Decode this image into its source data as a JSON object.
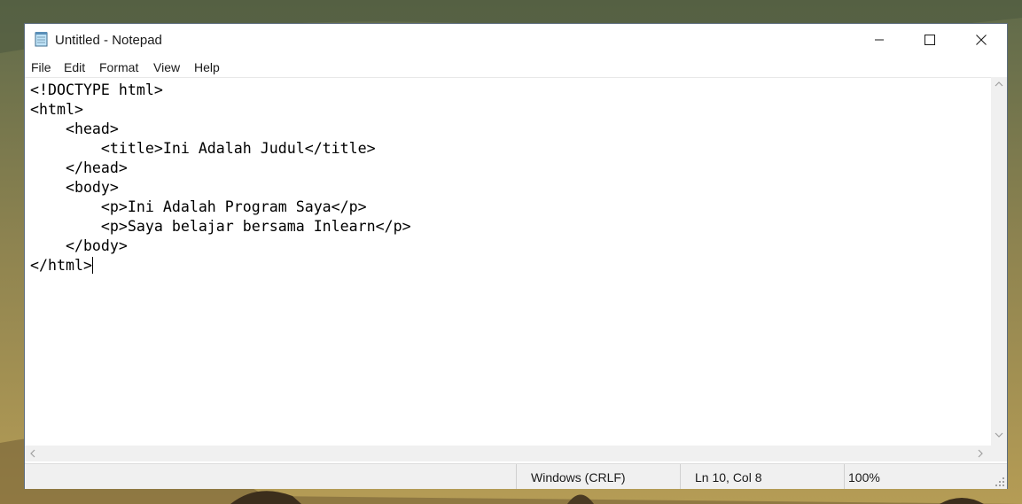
{
  "window": {
    "title": "Untitled - Notepad",
    "controls": {
      "minimize_icon": "minimize-icon",
      "maximize_icon": "maximize-icon",
      "close_icon": "close-icon"
    }
  },
  "menu": {
    "items": [
      "File",
      "Edit",
      "Format",
      "View",
      "Help"
    ]
  },
  "editor": {
    "lines": [
      "<!DOCTYPE html>",
      "<html>",
      "    <head>",
      "        <title>Ini Adalah Judul</title>",
      "    </head>",
      "    <body>",
      "        <p>Ini Adalah Program Saya</p>",
      "        <p>Saya belajar bersama Inlearn</p>",
      "    </body>",
      "</html>"
    ]
  },
  "status": {
    "line_endings": "Windows (CRLF)",
    "position": "Ln 10, Col 8",
    "zoom": "100%"
  },
  "colors": {
    "window_border": "#5d6d7e",
    "statusbar_bg": "#f0f0f0",
    "text": "#000000"
  }
}
